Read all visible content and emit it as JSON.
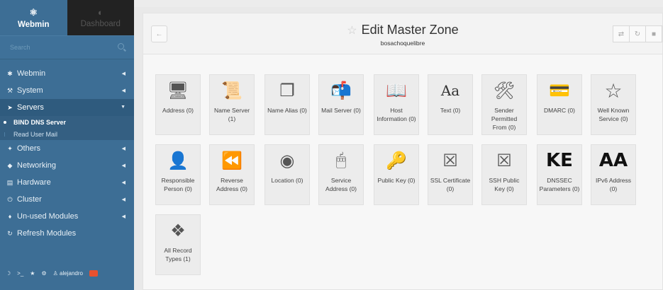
{
  "sidebar": {
    "tabs": [
      {
        "label": "Webmin",
        "icon": "webmin-logo-icon"
      },
      {
        "label": "Dashboard",
        "icon": "dashboard-icon"
      }
    ],
    "search_placeholder": "Search",
    "menu": [
      {
        "label": "Webmin",
        "icon": "gear-icon"
      },
      {
        "label": "System",
        "icon": "wrench-icon"
      },
      {
        "label": "Servers",
        "icon": "rocket-icon"
      },
      {
        "label": "Others",
        "icon": "wand-icon"
      },
      {
        "label": "Networking",
        "icon": "shield-icon"
      },
      {
        "label": "Hardware",
        "icon": "hdd-icon"
      },
      {
        "label": "Cluster",
        "icon": "power-icon"
      },
      {
        "label": "Un-used Modules",
        "icon": "puzzle-icon"
      },
      {
        "label": "Refresh Modules",
        "icon": "refresh-icon"
      }
    ],
    "submenu": [
      {
        "label": "BIND DNS Server"
      },
      {
        "label": "Read User Mail"
      }
    ],
    "user": "alejandro"
  },
  "header": {
    "title": "Edit Master Zone",
    "subtitle": "bosachoquelibre"
  },
  "tiles": [
    {
      "label": "Address (0)",
      "icon": "computer-icon"
    },
    {
      "label": "Name Server (1)",
      "icon": "certificate-icon"
    },
    {
      "label": "Name Alias (0)",
      "icon": "windows-icon"
    },
    {
      "label": "Mail Server (0)",
      "icon": "mailbox-icon"
    },
    {
      "label": "Host Information (0)",
      "icon": "book-icon"
    },
    {
      "label": "Text (0)",
      "icon": "text-aa-icon"
    },
    {
      "label": "Sender Permitted From (0)",
      "icon": "tools-icon"
    },
    {
      "label": "DMARC (0)",
      "icon": "card-icon"
    },
    {
      "label": "Well Known Service (0)",
      "icon": "star-icon"
    },
    {
      "label": "Responsible Person (0)",
      "icon": "person-icon"
    },
    {
      "label": "Reverse Address (0)",
      "icon": "rewind-icon"
    },
    {
      "label": "Location (0)",
      "icon": "location-icon"
    },
    {
      "label": "Service Address (0)",
      "icon": "server-icon"
    },
    {
      "label": "Public Key (0)",
      "icon": "key-icon"
    },
    {
      "label": "SSL Certificate (0)",
      "icon": "ssl-cert-icon"
    },
    {
      "label": "SSH Public Key (0)",
      "icon": "ssh-key-icon"
    },
    {
      "label": "DNSSEC Parameters (0)",
      "icon": "ke-letters-icon",
      "glyph": "KE"
    },
    {
      "label": "IPv6 Address (0)",
      "icon": "aa-letters-icon",
      "glyph": "AA"
    },
    {
      "label": "All Record Types (1)",
      "icon": "cubes-icon"
    }
  ]
}
